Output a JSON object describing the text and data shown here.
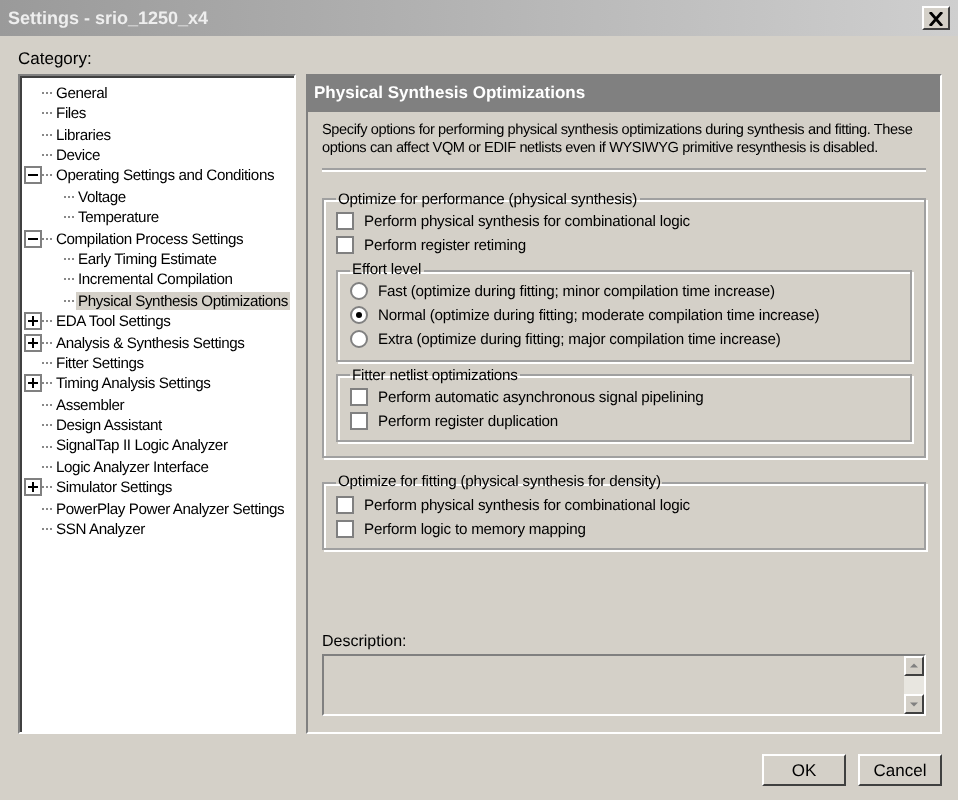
{
  "window": {
    "title": "Settings - srio_1250_x4"
  },
  "category_label": "Category:",
  "tree": [
    {
      "label": "General",
      "selected": false
    },
    {
      "label": "Files",
      "selected": false
    },
    {
      "label": "Libraries",
      "selected": false
    },
    {
      "label": "Device",
      "selected": false
    },
    {
      "label": "Operating Settings and Conditions",
      "selected": false,
      "expanded": true,
      "children": [
        {
          "label": "Voltage",
          "selected": false
        },
        {
          "label": "Temperature",
          "selected": false
        }
      ]
    },
    {
      "label": "Compilation Process Settings",
      "selected": false,
      "expanded": true,
      "children": [
        {
          "label": "Early Timing Estimate",
          "selected": false
        },
        {
          "label": "Incremental Compilation",
          "selected": false
        },
        {
          "label": "Physical Synthesis Optimizations",
          "selected": true
        }
      ]
    },
    {
      "label": "EDA Tool Settings",
      "selected": false,
      "expanded": false
    },
    {
      "label": "Analysis & Synthesis Settings",
      "selected": false,
      "expanded": false
    },
    {
      "label": "Fitter Settings",
      "selected": false
    },
    {
      "label": "Timing Analysis Settings",
      "selected": false,
      "expanded": false
    },
    {
      "label": "Assembler",
      "selected": false
    },
    {
      "label": "Design Assistant",
      "selected": false
    },
    {
      "label": "SignalTap II Logic Analyzer",
      "selected": false
    },
    {
      "label": "Logic Analyzer Interface",
      "selected": false
    },
    {
      "label": "Simulator Settings",
      "selected": false,
      "expanded": false
    },
    {
      "label": "PowerPlay Power Analyzer Settings",
      "selected": false
    },
    {
      "label": "SSN Analyzer",
      "selected": false
    }
  ],
  "panel": {
    "title": "Physical Synthesis Optimizations",
    "intro": "Specify options for performing physical synthesis optimizations during synthesis and fitting. These options can affect VQM or EDIF netlists even if WYSIWYG primitive resynthesis is disabled.",
    "groups": [
      {
        "title": "Optimize for performance (physical synthesis)",
        "items": [
          {
            "kind": "checkbox",
            "label": "Perform physical synthesis for combinational logic",
            "checked": false
          },
          {
            "kind": "checkbox",
            "label": "Perform register retiming",
            "checked": false
          },
          {
            "kind": "group",
            "title": "Effort level",
            "items": [
              {
                "kind": "radio",
                "label": "Fast (optimize during fitting; minor compilation time increase)",
                "selected": false
              },
              {
                "kind": "radio",
                "label": "Normal (optimize during fitting; moderate compilation time increase)",
                "selected": true
              },
              {
                "kind": "radio",
                "label": "Extra (optimize during fitting; major compilation time increase)",
                "selected": false
              }
            ]
          },
          {
            "kind": "group",
            "title": "Fitter netlist optimizations",
            "items": [
              {
                "kind": "checkbox",
                "label": "Perform automatic asynchronous signal pipelining",
                "checked": false
              },
              {
                "kind": "checkbox",
                "label": "Perform register duplication",
                "checked": false
              }
            ]
          }
        ]
      },
      {
        "title": "Optimize for fitting (physical synthesis for density)",
        "items": [
          {
            "kind": "checkbox",
            "label": "Perform physical synthesis for combinational logic",
            "checked": false
          },
          {
            "kind": "checkbox",
            "label": "Perform logic to memory mapping",
            "checked": false
          }
        ]
      }
    ],
    "description_label": "Description:"
  },
  "buttons": [
    "OK",
    "Cancel"
  ]
}
